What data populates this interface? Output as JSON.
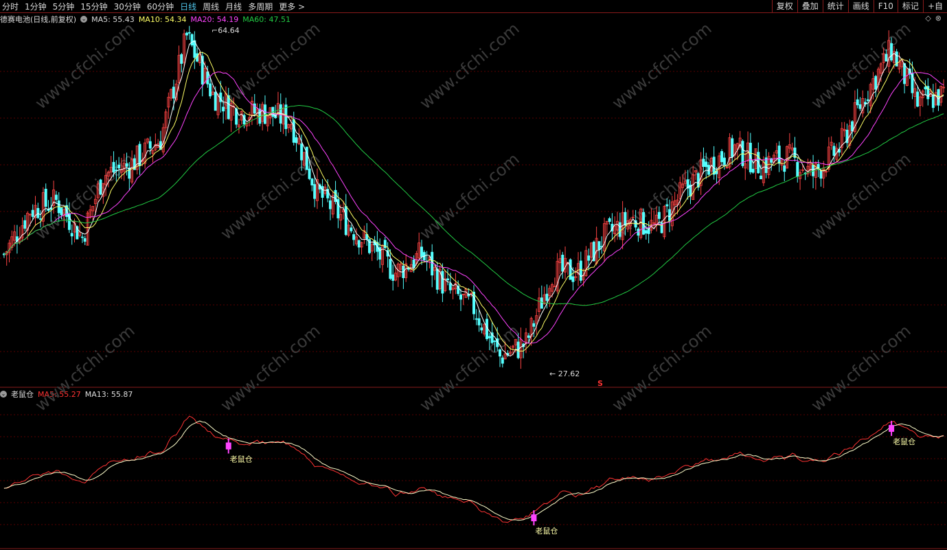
{
  "periods": [
    {
      "label": "分时",
      "active": false
    },
    {
      "label": "1分钟",
      "active": false
    },
    {
      "label": "5分钟",
      "active": false
    },
    {
      "label": "15分钟",
      "active": false
    },
    {
      "label": "30分钟",
      "active": false
    },
    {
      "label": "60分钟",
      "active": false
    },
    {
      "label": "日线",
      "active": true
    },
    {
      "label": "周线",
      "active": false
    },
    {
      "label": "月线",
      "active": false
    },
    {
      "label": "多周期",
      "active": false
    },
    {
      "label": "更多 >",
      "active": false
    }
  ],
  "tools": [
    "复权",
    "叠加",
    "统计",
    "画线",
    "F10",
    "标记",
    "+自"
  ],
  "main_legend": {
    "name": "德赛电池(日线,前复权)",
    "ma5": "MA5: 55.43",
    "ma10": "MA10: 54.34",
    "ma20": "MA20: 54.19",
    "ma60": "MA60: 47.51"
  },
  "indicator_legend": {
    "name": "老鼠仓",
    "ma5": "MA5: 55.27",
    "ma13": "MA13: 55.87"
  },
  "annotations": {
    "high": "64.64",
    "low": "27.62",
    "signal_label": "老鼠仓",
    "s_mark": "S"
  },
  "watermark": "www.cfchi.com",
  "colors": {
    "up": "#ff4444",
    "down": "#54ffff",
    "ma5": "#ffffff",
    "ma10": "#ffff66",
    "ma20": "#ff44ff",
    "ma60": "#22cc44",
    "grid": "#5a0000",
    "border": "#8a1b1b"
  },
  "chart_data": [
    {
      "type": "candlestick",
      "price_range": [
        26,
        66
      ],
      "high": 64.64,
      "low": 27.62,
      "anchors": [
        [
          0,
          40
        ],
        [
          10,
          45
        ],
        [
          20,
          46
        ],
        [
          30,
          42
        ],
        [
          38,
          49
        ],
        [
          48,
          50
        ],
        [
          60,
          53
        ],
        [
          70,
          64.5
        ],
        [
          80,
          58
        ],
        [
          90,
          56
        ],
        [
          100,
          56
        ],
        [
          110,
          55
        ],
        [
          120,
          47
        ],
        [
          130,
          44
        ],
        [
          140,
          41
        ],
        [
          150,
          38
        ],
        [
          160,
          40
        ],
        [
          170,
          36
        ],
        [
          180,
          34
        ],
        [
          190,
          28.5
        ],
        [
          200,
          30
        ],
        [
          210,
          38
        ],
        [
          220,
          38
        ],
        [
          230,
          42
        ],
        [
          240,
          44
        ],
        [
          250,
          43
        ],
        [
          260,
          47
        ],
        [
          270,
          50
        ],
        [
          280,
          52
        ],
        [
          290,
          50
        ],
        [
          300,
          51
        ],
        [
          310,
          49
        ],
        [
          320,
          52
        ],
        [
          330,
          58
        ],
        [
          340,
          63
        ],
        [
          350,
          57
        ],
        [
          360,
          58
        ]
      ],
      "series": [
        {
          "name": "MA5",
          "period": 5
        },
        {
          "name": "MA10",
          "period": 10
        },
        {
          "name": "MA20",
          "period": 20
        },
        {
          "name": "MA60",
          "period": 60
        }
      ]
    },
    {
      "type": "line",
      "name": "老鼠仓",
      "series": [
        {
          "name": "MA5"
        },
        {
          "name": "MA13"
        }
      ],
      "signals": [
        86,
        203,
        340
      ]
    }
  ]
}
